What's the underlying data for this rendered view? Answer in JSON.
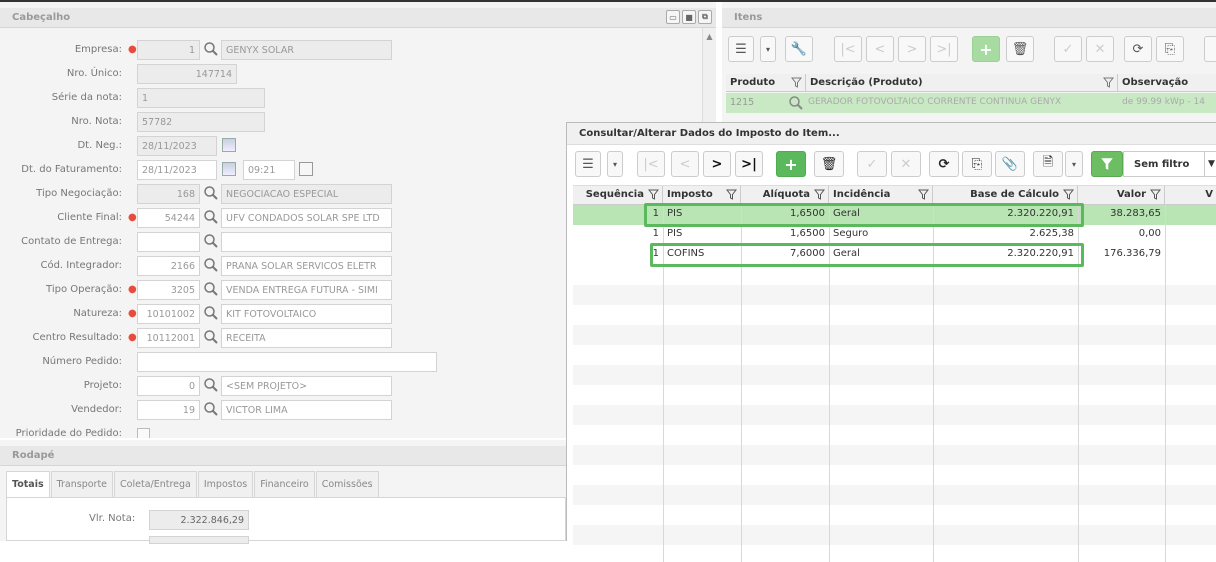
{
  "cabecalho": {
    "title": "Cabeçalho",
    "fields": {
      "empresa": {
        "label": "Empresa:",
        "code": "1",
        "name": "GENYX SOLAR"
      },
      "nro_unico": {
        "label": "Nro. Único:",
        "value": "147714"
      },
      "serie": {
        "label": "Série da nota:",
        "value": "1"
      },
      "nro_nota": {
        "label": "Nro. Nota:",
        "value": "57782"
      },
      "dt_neg": {
        "label": "Dt. Neg.:",
        "value": "28/11/2023"
      },
      "dt_fat": {
        "label": "Dt. do Faturamento:",
        "value": "28/11/2023",
        "time": "09:21"
      },
      "tipo_neg": {
        "label": "Tipo Negociação:",
        "code": "168",
        "name": "NEGOCIACAO ESPECIAL"
      },
      "cliente": {
        "label": "Cliente Final:",
        "code": "54244",
        "name": "UFV CONDADOS SOLAR SPE LTD"
      },
      "contato": {
        "label": "Contato de Entrega:",
        "code": "",
        "name": ""
      },
      "cod_integrador": {
        "label": "Cód. Integrador:",
        "code": "2166",
        "name": "PRANA SOLAR SERVICOS ELETR"
      },
      "tipo_oper": {
        "label": "Tipo Operação:",
        "code": "3205",
        "name": "VENDA ENTREGA FUTURA - SIMI"
      },
      "natureza": {
        "label": "Natureza:",
        "code": "10101002",
        "name": "KIT FOTOVOLTAICO"
      },
      "centro": {
        "label": "Centro Resultado:",
        "code": "10112001",
        "name": "RECEITA"
      },
      "num_pedido": {
        "label": "Número Pedido:",
        "value": ""
      },
      "projeto": {
        "label": "Projeto:",
        "code": "0",
        "name": "<SEM PROJETO>"
      },
      "vendedor": {
        "label": "Vendedor:",
        "code": "19",
        "name": "VICTOR LIMA"
      },
      "prioridade": {
        "label": "Prioridade do Pedido:"
      }
    }
  },
  "rodape": {
    "title": "Rodapé",
    "tabs": [
      "Totais",
      "Transporte",
      "Coleta/Entrega",
      "Impostos",
      "Financeiro",
      "Comissões"
    ],
    "vlr_nota_label": "Vlr. Nota:",
    "vlr_nota": "2.322.846,29"
  },
  "itens": {
    "title": "Itens",
    "columns": [
      "Produto",
      "Descrição (Produto)",
      "Observação"
    ],
    "row": {
      "produto": "1215",
      "descricao": "GERADOR FOTOVOLTAICO CORRENTE CONTINUA GENYX",
      "observacao": "de 99.99 kWp - 14"
    }
  },
  "modal": {
    "title": "Consultar/Alterar Dados do Imposto do Item...",
    "filter_label": "Sem filtro",
    "columns": [
      "Sequência",
      "Imposto",
      "Alíquota",
      "Incidência",
      "Base de Cálculo",
      "Valor",
      "V"
    ],
    "rows": [
      {
        "seq": "1",
        "imposto": "PIS",
        "aliquota": "1,6500",
        "incidencia": "Geral",
        "base": "2.320.220,91",
        "valor": "38.283,65"
      },
      {
        "seq": "1",
        "imposto": "PIS",
        "aliquota": "1,6500",
        "incidencia": "Seguro",
        "base": "2.625,38",
        "valor": "0,00"
      },
      {
        "seq": "1",
        "imposto": "COFINS",
        "aliquota": "7,6000",
        "incidencia": "Geral",
        "base": "2.320.220,91",
        "valor": "176.336,79"
      }
    ]
  },
  "colors": {
    "accent_green": "#5cb85c",
    "selected_row": "#b9e4b4"
  }
}
